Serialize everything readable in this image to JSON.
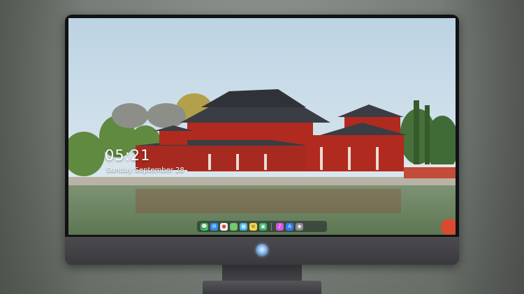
{
  "lock_screen": {
    "time": "05:21",
    "date": "Sunday September  28"
  },
  "dock": {
    "apps": [
      {
        "name": "messages-icon",
        "color": "#35c759",
        "glyph": "💬"
      },
      {
        "name": "mail-icon",
        "color": "#2f8cf3",
        "glyph": "✉"
      },
      {
        "name": "chrome-icon",
        "color": "#f1f1f1",
        "glyph": "●"
      },
      {
        "name": "maps-icon",
        "color": "#6ac36a",
        "glyph": "⬚"
      },
      {
        "name": "photos-icon",
        "color": "#4ab3e8",
        "glyph": "▦"
      },
      {
        "name": "notes-icon",
        "color": "#f6d24a",
        "glyph": "≡"
      },
      {
        "name": "facetime-icon",
        "color": "#38b56a",
        "glyph": "▣"
      },
      {
        "name": "itunes-icon",
        "color": "#d656e6",
        "glyph": "♪"
      },
      {
        "name": "app-store-icon",
        "color": "#2f7ef3",
        "glyph": "A"
      },
      {
        "name": "camera-icon",
        "color": "#8a8a8f",
        "glyph": "◉"
      }
    ]
  },
  "colors": {
    "sky": "#cfe0ea",
    "temple_red": "#b12a1f",
    "roof": "#3a3d44",
    "water": "#6e8c63"
  }
}
